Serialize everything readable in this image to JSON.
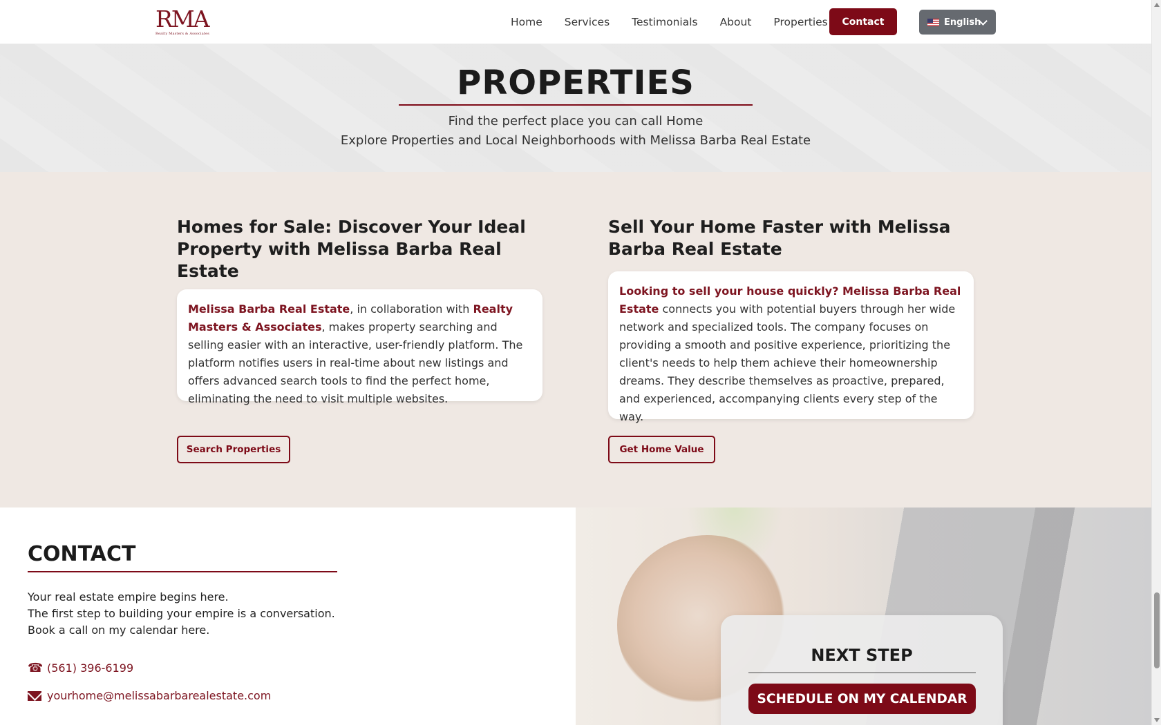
{
  "header": {
    "logo_mark": "RMA",
    "logo_sub": "Realty Masters & Associates",
    "nav": [
      "Home",
      "Services",
      "Testimonials",
      "About",
      "Properties"
    ],
    "contact_label": "Contact",
    "language": "English"
  },
  "hero": {
    "title": "PROPERTIES",
    "subtitle1": "Find the perfect place you can call Home",
    "subtitle2": "Explore Properties and Local Neighborhoods with Melissa Barba Real Estate"
  },
  "buy": {
    "heading": "Homes for Sale: Discover Your Ideal Property with Melissa Barba Real Estate",
    "brand1": "Melissa Barba Real Estate",
    "text1": ", in collaboration with ",
    "brand2": "Realty Masters & Associates",
    "text2": ", makes property searching and selling easier with an interactive, user-friendly platform. The platform notifies users in real-time about new listings and offers advanced search tools to find the perfect home, eliminating the need to visit multiple websites.",
    "button": "Search Properties"
  },
  "sell": {
    "heading": "Sell Your Home Faster with Melissa Barba Real Estate",
    "lead": "Looking to sell your house quickly? Melissa Barba Real Estate",
    "text": "connects you with potential buyers through her wide network and specialized tools. The company focuses on providing a smooth and positive experience, prioritizing the client's needs to help them achieve their homeownership dreams. They describe themselves as proactive, prepared, and experienced, accompanying clients every step of the way.",
    "button": "Get Home Value"
  },
  "contact": {
    "title": "CONTACT",
    "line1": "Your real estate empire begins here.",
    "line2": "The first step to building your empire is a conversation.",
    "line3": "Book a call on my calendar here.",
    "phone": "(561) 396-6199",
    "email": "yourhome@melissabarbarealestate.com"
  },
  "next_step": {
    "title": "NEXT STEP",
    "button": "SCHEDULE ON MY CALENDAR"
  },
  "icons": [
    "phone-icon",
    "mail-icon",
    "chevron-down-icon",
    "us-flag-icon"
  ],
  "colors": {
    "brand": "#7d0a17",
    "section_bg": "#efe8e3",
    "lang_bg": "#666a70"
  }
}
